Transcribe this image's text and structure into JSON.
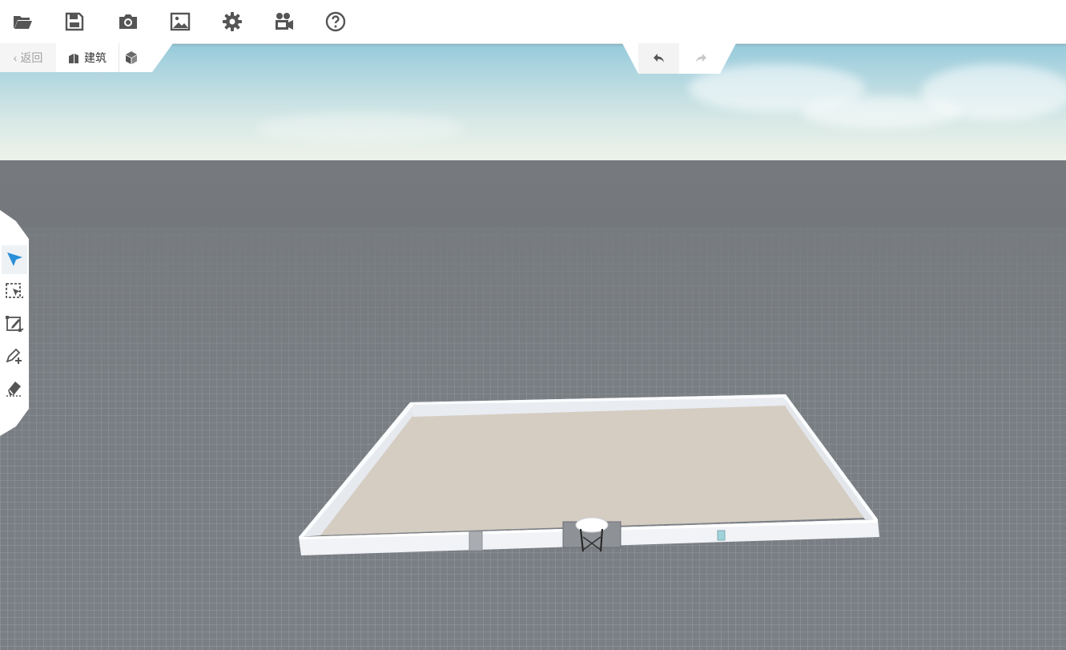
{
  "toolbar": {
    "buttons": [
      {
        "name": "open-folder-icon",
        "tooltip": ""
      },
      {
        "name": "save-icon",
        "tooltip": ""
      },
      {
        "name": "camera-icon",
        "tooltip": ""
      },
      {
        "name": "image-icon",
        "tooltip": ""
      },
      {
        "name": "gear-icon",
        "tooltip": ""
      },
      {
        "name": "video-camera-icon",
        "tooltip": ""
      },
      {
        "name": "help-icon",
        "tooltip": ""
      }
    ]
  },
  "subbar": {
    "back_label": "返回",
    "building_label": "建筑"
  },
  "history": {
    "undo_icon": "undo-icon",
    "redo_icon": "redo-icon"
  },
  "left_tools": [
    {
      "name": "select-arrow-icon",
      "active": true
    },
    {
      "name": "box-select-icon",
      "active": false
    },
    {
      "name": "edit-shape-icon",
      "active": false
    },
    {
      "name": "pen-add-icon",
      "active": false
    },
    {
      "name": "eraser-icon",
      "active": false
    }
  ],
  "colors": {
    "accent": "#2a8fd8",
    "icon": "#555555",
    "floor": "#d5cdc2",
    "wall": "#f1f3f7"
  }
}
